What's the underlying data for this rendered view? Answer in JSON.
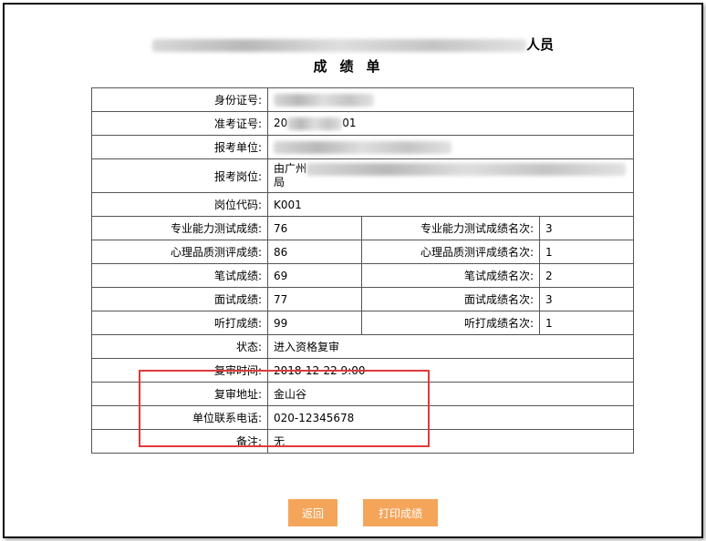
{
  "header": {
    "title_line1_suffix": "人员",
    "title_line2": "成绩单"
  },
  "rows": {
    "id_number": {
      "label": "身份证号:"
    },
    "exam_number": {
      "label": "准考证号:",
      "value_prefix": "20",
      "value_suffix": "01"
    },
    "unit": {
      "label": "报考单位:"
    },
    "position": {
      "label": "报考岗位:",
      "value_prefix": "由广州",
      "value_line2": "局"
    },
    "position_code": {
      "label": "岗位代码:",
      "value": "K001"
    },
    "professional": {
      "label": "专业能力测试成绩:",
      "value": "76",
      "rank_label": "专业能力测试成绩名次:",
      "rank": "3"
    },
    "psychology": {
      "label": "心理品质测评成绩:",
      "value": "86",
      "rank_label": "心理品质测评成绩名次:",
      "rank": "1"
    },
    "written": {
      "label": "笔试成绩:",
      "value": "69",
      "rank_label": "笔试成绩名次:",
      "rank": "2"
    },
    "interview": {
      "label": "面试成绩:",
      "value": "77",
      "rank_label": "面试成绩名次:",
      "rank": "3"
    },
    "typing": {
      "label": "听打成绩:",
      "value": "99",
      "rank_label": "听打成绩名次:",
      "rank": "1"
    },
    "status": {
      "label": "状态:",
      "value": "进入资格复审"
    },
    "review_time": {
      "label": "复审时间:",
      "value": "2018-12-22 9:00"
    },
    "review_address": {
      "label": "复审地址:",
      "value": "金山谷"
    },
    "contact_phone": {
      "label": "单位联系电话:",
      "value": "020-12345678"
    },
    "remarks": {
      "label": "备注:",
      "value": "无"
    }
  },
  "buttons": {
    "back": "返回",
    "print": "打印成绩"
  },
  "colors": {
    "button_bg": "#f5a55a",
    "highlight_border": "#e03a3a"
  }
}
